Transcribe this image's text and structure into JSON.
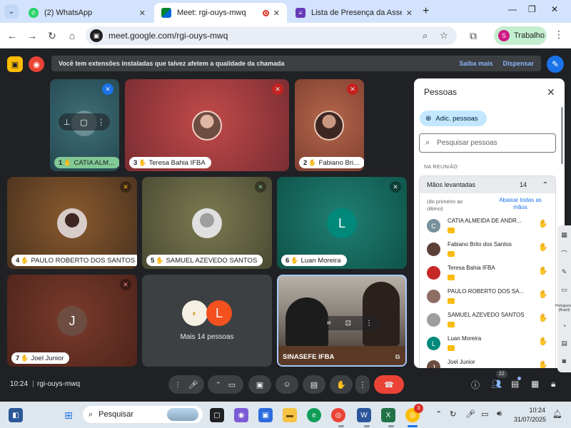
{
  "browser": {
    "tabs": [
      {
        "title": "(2) WhatsApp",
        "icon": "whatsapp-icon"
      },
      {
        "title": "Meet: rgi-ouys-mwq",
        "icon": "google-meet-icon",
        "recording": true
      },
      {
        "title": "Lista de Presença da Assembleia",
        "icon": "google-forms-icon"
      }
    ],
    "url": "meet.google.com/rgi-ouys-mwq",
    "profile": {
      "initial": "S",
      "name": "Trabalho"
    }
  },
  "meet": {
    "banner": {
      "text": "Você tem extensões instaladas que talvez afetem a qualidade da chamada",
      "learn_more": "Saiba mais",
      "dismiss": "Dispensar"
    },
    "tiles": [
      {
        "hand": "1",
        "name": "CATIA ALMEIDA DE ANDRADE",
        "display": "CATIA ALM..."
      },
      {
        "hand": "3",
        "name": "Teresa Bahia IFBA"
      },
      {
        "hand": "2",
        "name": "Fabiano Brito dos Santos",
        "display": "Fabiano Bri..."
      },
      {
        "hand": "4",
        "name": "PAULO ROBERTO DOS SANTOS"
      },
      {
        "hand": "5",
        "name": "SAMUEL AZEVEDO SANTOS"
      },
      {
        "hand": "6",
        "name": "Luan Moreira",
        "initial": "L"
      },
      {
        "hand": "7",
        "name": "Joel Junior",
        "initial": "J"
      },
      {
        "more_label": "Mais 14 pessoas",
        "initial": "L"
      },
      {
        "name": "SINASEFE IFBA"
      }
    ],
    "people_panel": {
      "title": "Pessoas",
      "add_label": "Adic. pessoas",
      "search_placeholder": "Pesquisar pessoas",
      "section": "NA REUNIÃO",
      "hands_label": "Mãos levantadas",
      "hands_count": "14",
      "order_label": "(do primeiro ao último)",
      "lower_all": "Abaixar todas as mãos",
      "people": [
        {
          "name": "CATIA ALMEIDA DE ANDR...",
          "initial": "C",
          "color": "#78909c"
        },
        {
          "name": "Fabiano Brito dos Santos",
          "initial": "",
          "color": "#5d4037"
        },
        {
          "name": "Teresa Bahia IFBA",
          "initial": "",
          "color": "#c62828"
        },
        {
          "name": "PAULO ROBERTO DOS SA...",
          "initial": "",
          "color": "#8d6e63"
        },
        {
          "name": "SAMUEL AZEVEDO SANTOS",
          "initial": "",
          "color": "#9e9e9e"
        },
        {
          "name": "Luan Moreira",
          "initial": "L",
          "color": "#00897b"
        },
        {
          "name": "Joel Junior",
          "initial": "J",
          "color": "#6d4c41"
        }
      ]
    },
    "bottom": {
      "time": "10:24",
      "code": "rgi-ouys-mwq",
      "participants_count": "22"
    }
  },
  "side_strip": {
    "label": "Portuguese (Brazil)"
  },
  "taskbar": {
    "search_placeholder": "Pesquisar",
    "notification_count": "3",
    "time": "10:24",
    "date": "31/07/2025"
  },
  "colors": {
    "meet_bg": "#202124",
    "accent_blue": "#1a73e8",
    "end_call_red": "#ea4335",
    "name_chip_green": "#81c995"
  }
}
